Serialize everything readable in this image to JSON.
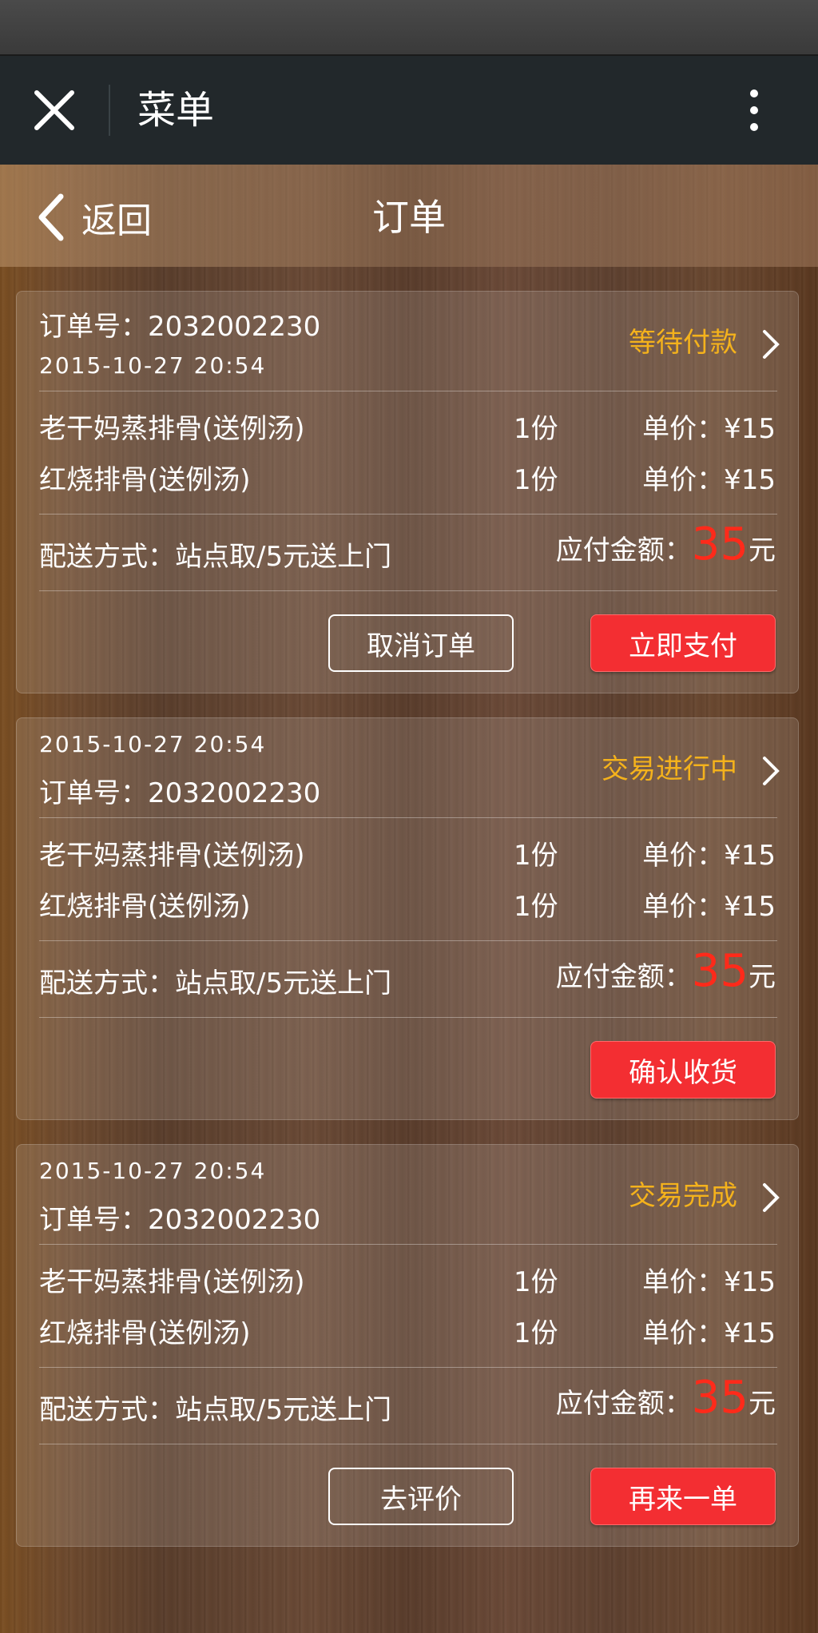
{
  "header": {
    "title": "菜单"
  },
  "nav": {
    "back_label": "返回",
    "title": "订单"
  },
  "orders": [
    {
      "order_no": "订单号：2032002230",
      "datetime": "2015-10-27    20:54",
      "status": "等待付款",
      "items": [
        {
          "name": "老干妈蒸排骨(送例汤)",
          "qty": "1份",
          "price": "单价：¥15"
        },
        {
          "name": "红烧排骨(送例汤)",
          "qty": "1份",
          "price": "单价：¥15"
        }
      ],
      "delivery": "配送方式：站点取/5元送上门",
      "amount_label": "应付金额：",
      "amount": "35",
      "amount_unit": "元",
      "buttons": {
        "outline": "取消订单",
        "primary": "立即支付"
      }
    },
    {
      "order_no": "订单号：2032002230",
      "datetime": "2015-10-27    20:54",
      "status": "交易进行中",
      "items": [
        {
          "name": "老干妈蒸排骨(送例汤)",
          "qty": "1份",
          "price": "单价：¥15"
        },
        {
          "name": "红烧排骨(送例汤)",
          "qty": "1份",
          "price": "单价：¥15"
        }
      ],
      "delivery": "配送方式：站点取/5元送上门",
      "amount_label": "应付金额：",
      "amount": "35",
      "amount_unit": "元",
      "buttons": {
        "primary": "确认收货"
      }
    },
    {
      "order_no": "订单号：2032002230",
      "datetime": "2015-10-27    20:54",
      "status": "交易完成",
      "items": [
        {
          "name": "老干妈蒸排骨(送例汤)",
          "qty": "1份",
          "price": "单价：¥15"
        },
        {
          "name": "红烧排骨(送例汤)",
          "qty": "1份",
          "price": "单价：¥15"
        }
      ],
      "delivery": "配送方式：站点取/5元送上门",
      "amount_label": "应付金额：",
      "amount": "35",
      "amount_unit": "元",
      "buttons": {
        "outline": "去评价",
        "primary": "再来一单"
      }
    }
  ],
  "colors": {
    "status": "#f4b21c",
    "amount": "#ff2a1a",
    "primary_button": "#f32e32",
    "topbar": "#22282b"
  }
}
